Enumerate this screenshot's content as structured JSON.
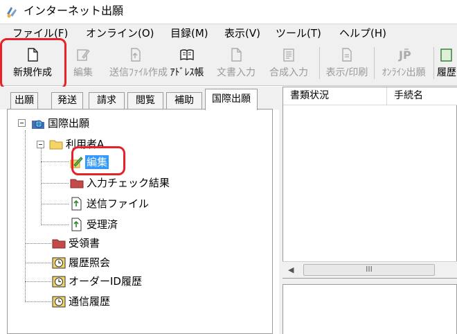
{
  "window": {
    "title": "インターネット出願"
  },
  "menu": [
    {
      "label": "ファイル(F)"
    },
    {
      "label": "オンライン(O)"
    },
    {
      "label": "目録(M)"
    },
    {
      "label": "表示(V)"
    },
    {
      "label": "ツール(T)"
    },
    {
      "label": "ヘルプ(H)"
    }
  ],
  "toolbar": {
    "new": "新規作成",
    "edit": "編集",
    "send_file_create": "送信ﾌｧｲﾙ作成",
    "address_book": "ｱﾄﾞﾚｽ帳",
    "doc_input": "文書入力",
    "compose_input": "合成入力",
    "display_print": "表示/印刷",
    "online_apply": "ｵﾝﾗｲﾝ出願",
    "history": "履歴"
  },
  "tabs": [
    {
      "label": "出願"
    },
    {
      "label": "発送"
    },
    {
      "label": "請求"
    },
    {
      "label": "閲覧"
    },
    {
      "label": "補助"
    },
    {
      "label": "国際出願"
    }
  ],
  "tree": {
    "root": "国際出願",
    "user": "利用者A",
    "edit": "編集",
    "input_check": "入力チェック結果",
    "send_file": "送信ファイル",
    "accepted": "受理済",
    "receipt": "受領書",
    "history_query": "履歴照会",
    "order_id_history": "オーダーID履歴",
    "comm_history": "通信履歴"
  },
  "list": {
    "columns": [
      "書類状況",
      "手続名"
    ],
    "scroll_thumb": "III"
  },
  "colors": {
    "highlight": "#e8202a",
    "selection": "#3399ff",
    "folder": "#f2d46b",
    "red_item": "#c44a4a"
  }
}
